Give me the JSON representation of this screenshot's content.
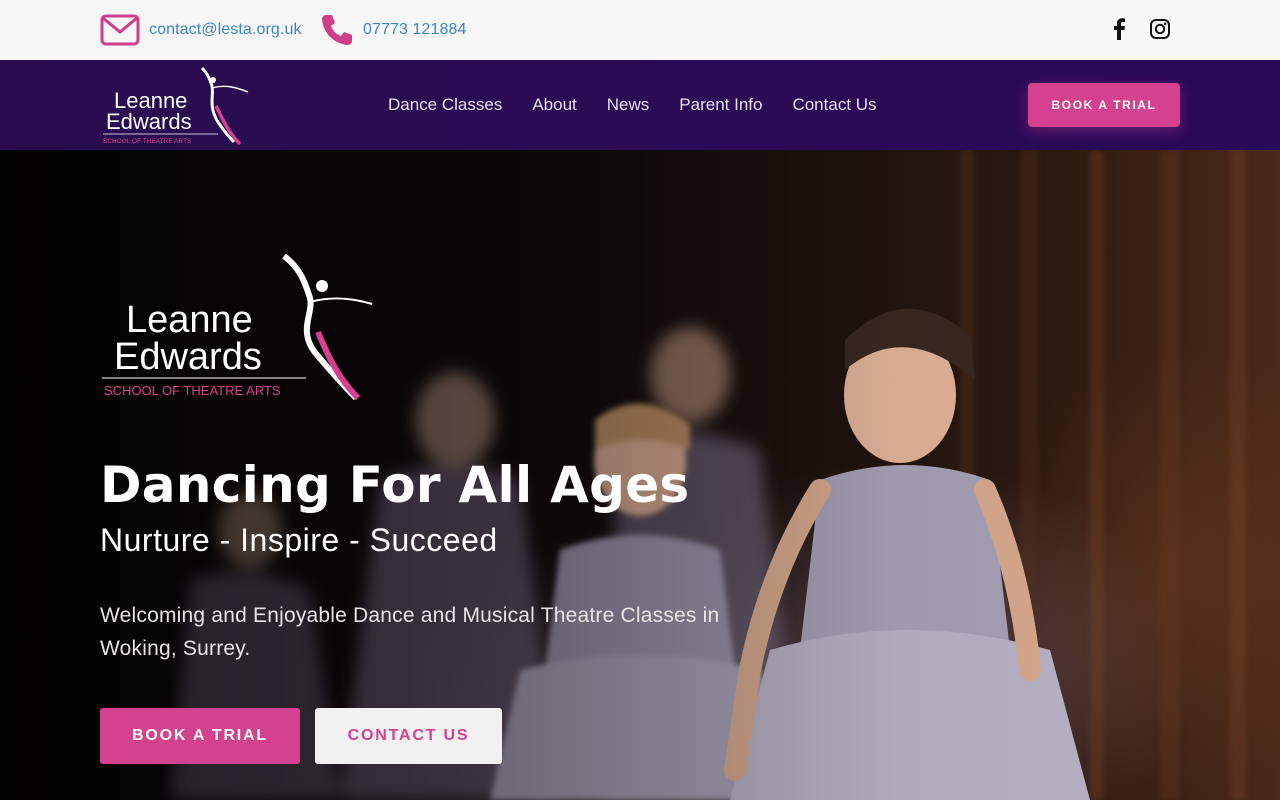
{
  "topbar": {
    "email": "contact@lesta.org.uk",
    "phone": "07773 121884",
    "email_icon": "envelope-icon",
    "phone_icon": "phone-icon",
    "social_icons": [
      "facebook-icon",
      "instagram-icon"
    ]
  },
  "brand": {
    "name_line1": "Leanne",
    "name_line2": "Edwards",
    "tagline": "SCHOOL OF THEATRE ARTS"
  },
  "nav": {
    "items": [
      {
        "label": "Dance Classes"
      },
      {
        "label": "About"
      },
      {
        "label": "News"
      },
      {
        "label": "Parent Info"
      },
      {
        "label": "Contact Us"
      }
    ],
    "cta": "BOOK A TRIAL"
  },
  "hero": {
    "title": "Dancing For All Ages",
    "subtitle": "Nurture - Inspire - Succeed",
    "description": "Welcoming and Enjoyable Dance and Musical Theatre Classes in Woking, Surrey.",
    "primary_button": "BOOK A TRIAL",
    "secondary_button": "CONTACT US"
  },
  "colors": {
    "accent_pink": "#d4418e",
    "nav_purple": "#2a0c4f",
    "link_blue": "#3e86c2"
  }
}
